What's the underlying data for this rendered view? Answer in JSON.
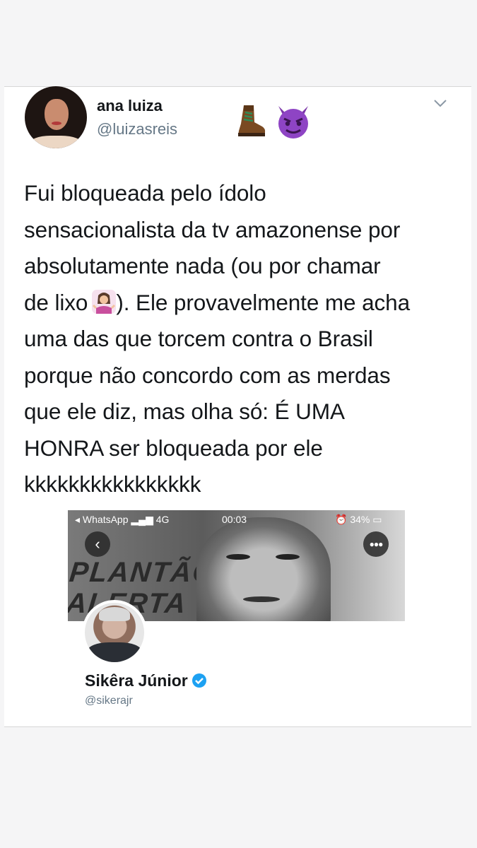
{
  "tweet": {
    "display_name": "ana luiza",
    "handle": "@luizasreis",
    "name_emojis": [
      "hiking-boot-icon",
      "smiling-devil-icon"
    ],
    "text_lines": [
      "Fui bloqueada pelo ídolo",
      "sensacionalista da tv amazonense por",
      "absolutamente nada (ou por chamar",
      "de lixo",
      "). Ele provavelmente me acha",
      "uma das que torcem contra o Brasil",
      "porque não concordo com as merdas",
      "que ele diz, mas olha só: É UMA",
      "HONRA ser bloqueada por ele",
      "kkkkkkkkkkkkkkkk"
    ],
    "inline_emoji": "woman-shrugging-icon"
  },
  "embedded_screenshot": {
    "status_bar": {
      "carrier": "◂ WhatsApp",
      "network": "4G",
      "time": "00:03",
      "battery": "34%"
    },
    "back_icon": "chevron-left-icon",
    "more_icon": "more-options-icon",
    "banner_text": [
      "PLANTÃO",
      "ALERTA"
    ],
    "profile": {
      "name": "Sikêra Júnior",
      "handle": "@sikerajr",
      "verified": true
    }
  },
  "colors": {
    "background": "#f5f5f6",
    "text": "#14171a",
    "secondary_text": "#657786",
    "verified_blue": "#1da1f2"
  }
}
